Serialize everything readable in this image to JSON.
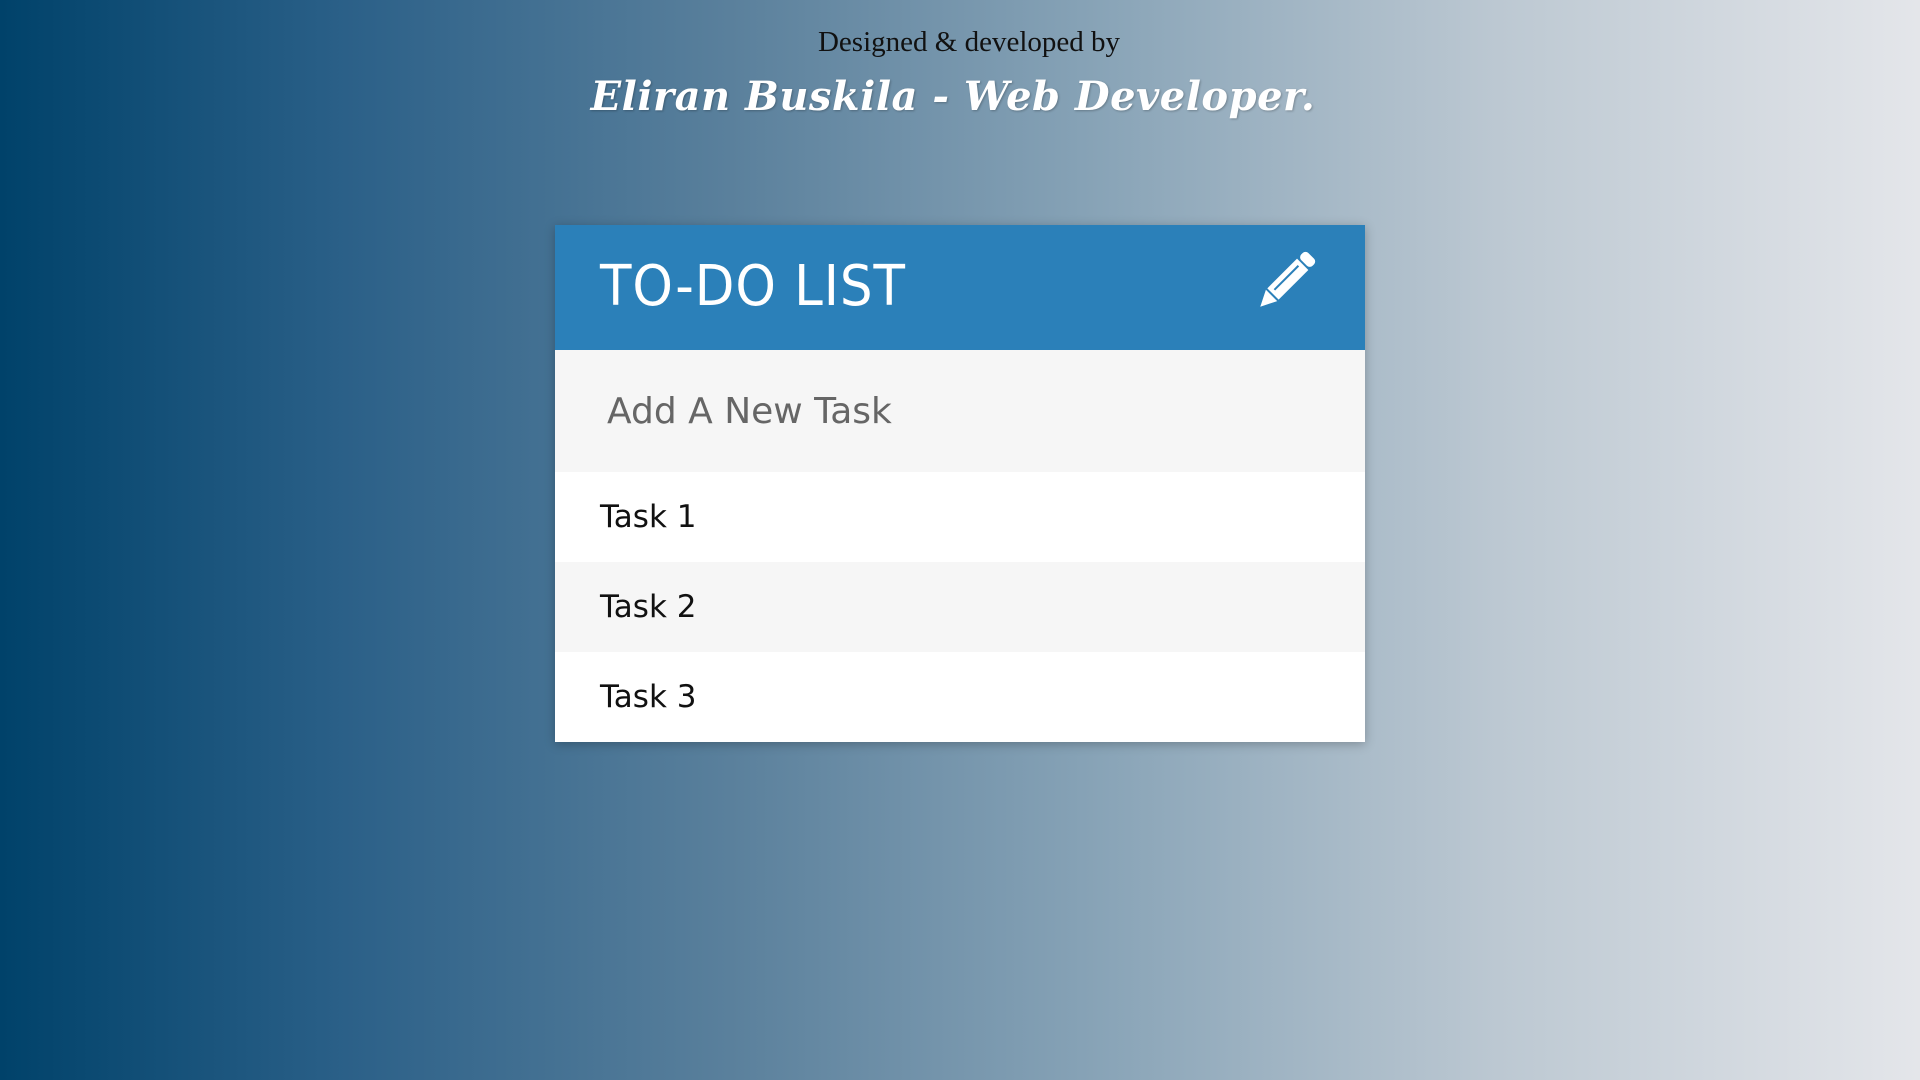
{
  "credits": {
    "line1": "Designed & developed by",
    "line2": "Eliran Buskila - Web Developer."
  },
  "todo": {
    "title": "TO-DO LIST",
    "add_icon": "pencil-icon",
    "new_task_placeholder": "Add A New Task",
    "new_task_value": "",
    "tasks": [
      {
        "label": "Task 1"
      },
      {
        "label": "Task 2"
      },
      {
        "label": "Task 3"
      }
    ]
  },
  "colors": {
    "header": "#2b80b9",
    "input_bg": "#f6f6f6",
    "row_alt": "#f6f6f6",
    "row": "#ffffff",
    "gradient_start": "#00426a",
    "gradient_end": "#e4e6ea"
  }
}
